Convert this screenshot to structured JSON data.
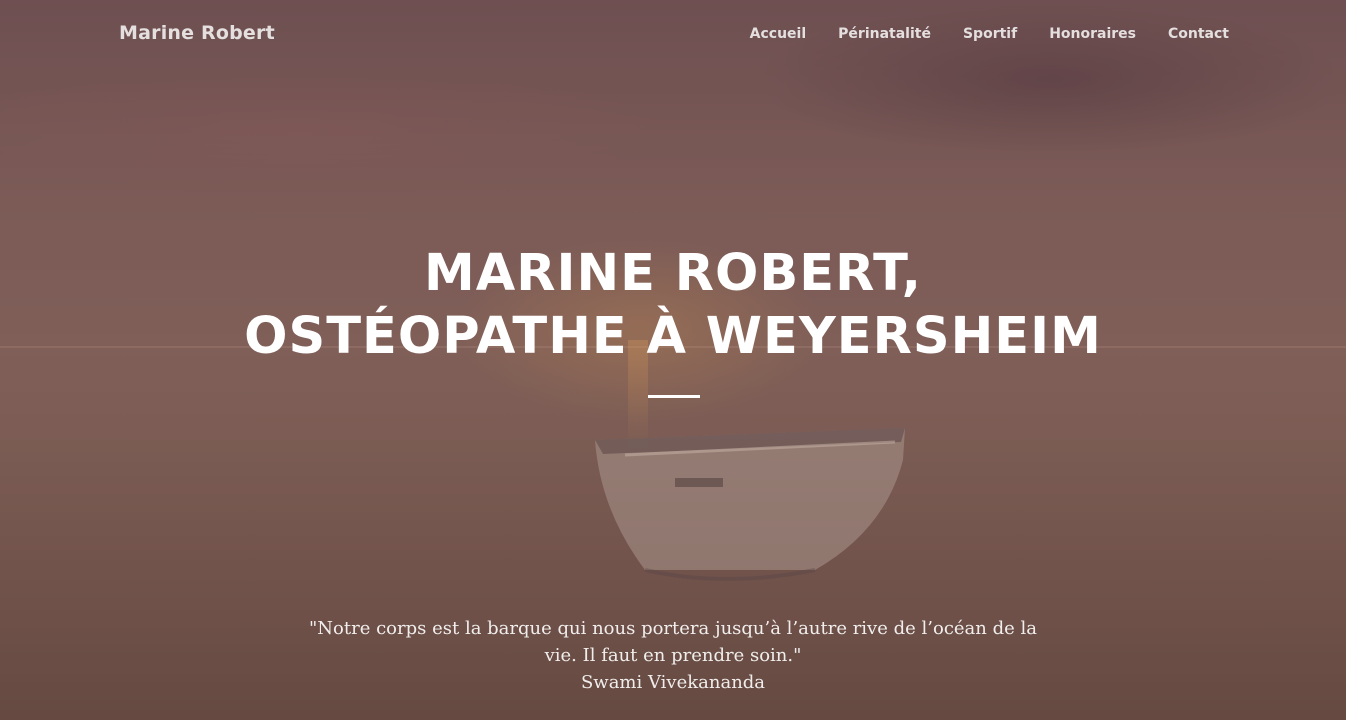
{
  "header": {
    "brand": "Marine Robert",
    "nav": [
      "Accueil",
      "Périnatalité",
      "Sportif",
      "Honoraires",
      "Contact"
    ]
  },
  "hero": {
    "title_line1": "MARINE ROBERT,",
    "title_line2": "OSTÉOPATHE À WEYERSHEIM",
    "quote_line1": "\"Notre corps est la barque qui nous portera jusqu’à l’autre rive de l’océan de la",
    "quote_line2": "vie. Il faut en prendre soin.\"",
    "quote_author": "Swami Vivekananda"
  },
  "colors": {
    "text": "#ffffff",
    "overlay": "#6f5449"
  }
}
